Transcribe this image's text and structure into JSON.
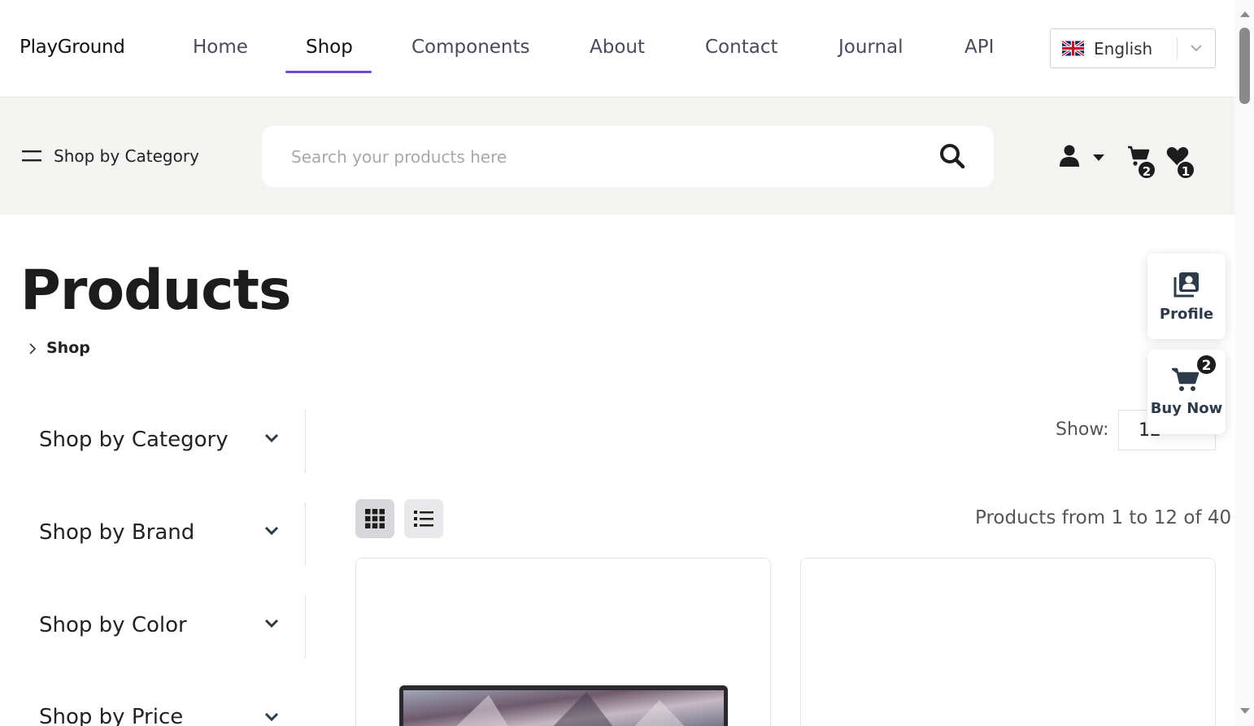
{
  "brand": {
    "name": "PlayGround"
  },
  "nav": {
    "items": [
      {
        "label": "Home",
        "active": false
      },
      {
        "label": "Shop",
        "active": true
      },
      {
        "label": "Components",
        "active": false
      },
      {
        "label": "About",
        "active": false
      },
      {
        "label": "Contact",
        "active": false
      },
      {
        "label": "Journal",
        "active": false
      },
      {
        "label": "API",
        "active": false
      }
    ],
    "accent_color": "#6c4cd6"
  },
  "language": {
    "selected": "English",
    "flag_icon": "uk-flag-icon"
  },
  "toolbar": {
    "category_label": "Shop by Category",
    "search_placeholder": "Search your products here",
    "cart_count": "2",
    "wishlist_count": "1"
  },
  "page": {
    "title": "Products",
    "breadcrumb": "Shop"
  },
  "filters": [
    {
      "label": "Shop by Category"
    },
    {
      "label": "Shop by Brand"
    },
    {
      "label": "Shop by Color"
    },
    {
      "label": "Shop by Price"
    }
  ],
  "listing": {
    "show_label": "Show:",
    "show_value": "12",
    "count_text": "Products from 1 to 12 of 40"
  },
  "widgets": {
    "profile_label": "Profile",
    "buy_now_label": "Buy Now",
    "buy_now_count": "2"
  }
}
